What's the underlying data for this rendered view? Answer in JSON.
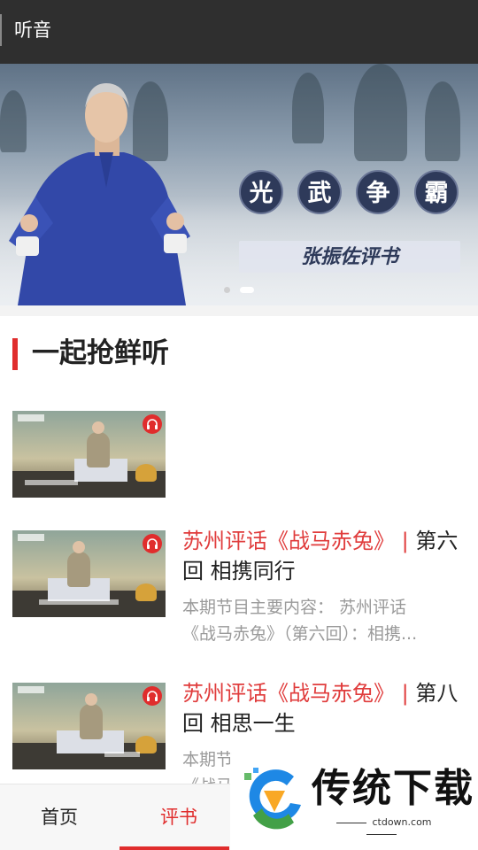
{
  "app": {
    "title": "听音"
  },
  "banner": {
    "seal_chars": [
      "光",
      "武",
      "争",
      "霸"
    ],
    "subtitle": "张振佐评书",
    "active_page": 2,
    "page_count": 2
  },
  "section": {
    "title": "一起抢鲜听"
  },
  "items": [
    {
      "title_red": "",
      "title_sep": "",
      "title_rest": "",
      "desc_line1": "",
      "desc_line2": ""
    },
    {
      "title_red": "苏州评话《战马赤兔》",
      "title_sep": " | ",
      "title_rest": "第六回 相携同行",
      "desc_line1": "本期节目主要内容：  苏州评话",
      "desc_line2": "《战马赤兔》（第六回）：相携..."
    },
    {
      "title_red": "苏州评话《战马赤兔》",
      "title_sep": " | ",
      "title_rest": "第八回 相思一生",
      "desc_line1": "本期节",
      "desc_line2": "《战马"
    }
  ],
  "tabs": [
    {
      "label": "首页"
    },
    {
      "label": "评书"
    }
  ],
  "watermark": {
    "text": "传统下载",
    "url": "ctdown.com"
  },
  "colors": {
    "accent": "#e02d2d",
    "topbar": "#2f2f2f",
    "title_red": "#e03c3c"
  }
}
